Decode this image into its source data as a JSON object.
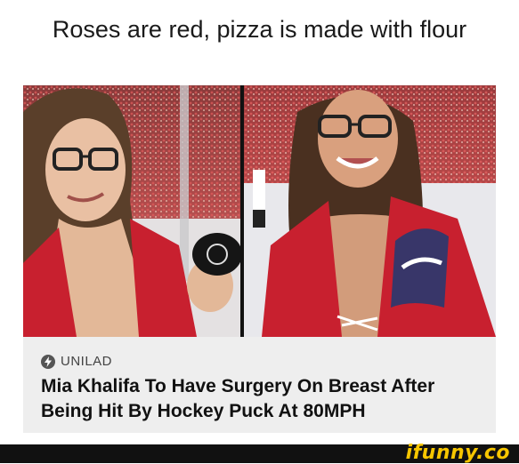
{
  "caption": "Roses are red, pizza is made with flour",
  "article": {
    "source": "UNILAD",
    "headline": "Mia Khalifa To Have Surgery On Breast After Being Hit By Hockey Puck At 80MPH",
    "source_icon": "bolt-icon"
  },
  "watermark": "ifunny.co",
  "colors": {
    "jersey_red": "#c8202f",
    "watermark": "#f7c600",
    "card_bg": "#eeeeee"
  }
}
